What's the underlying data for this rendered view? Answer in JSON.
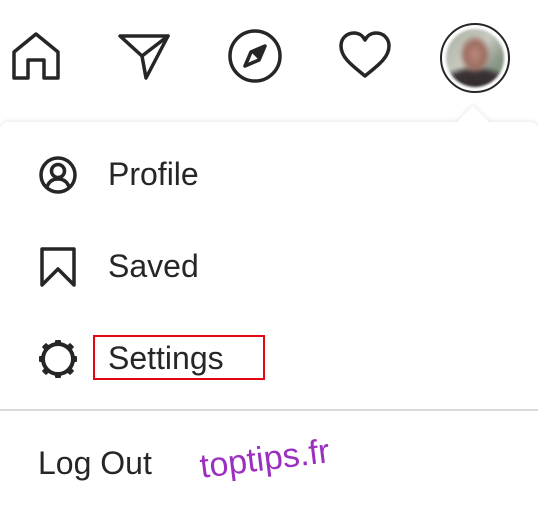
{
  "nav": {
    "items": [
      {
        "icon": "home-icon"
      },
      {
        "icon": "send-icon"
      },
      {
        "icon": "explore-compass-icon"
      },
      {
        "icon": "heart-icon"
      },
      {
        "icon": "profile-avatar"
      }
    ]
  },
  "menu": {
    "items": [
      {
        "label": "Profile",
        "icon": "user-circle-icon"
      },
      {
        "label": "Saved",
        "icon": "bookmark-icon"
      },
      {
        "label": "Settings",
        "icon": "gear-icon",
        "highlighted": true
      }
    ],
    "logout_label": "Log Out"
  },
  "watermark": {
    "text": "toptips.fr",
    "color": "#9b2fbf"
  },
  "colors": {
    "icon": "#262626",
    "highlight": "#e30613",
    "divider": "#dbdbdb"
  }
}
